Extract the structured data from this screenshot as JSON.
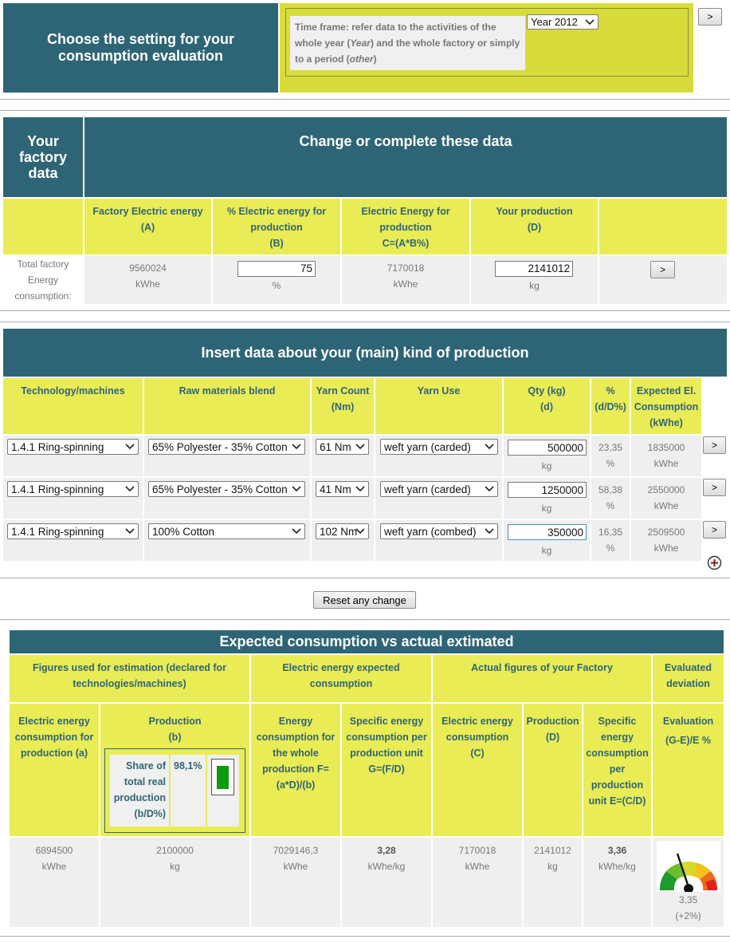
{
  "settings": {
    "title_line1": "Choose the setting for your",
    "title_line2": "consumption evaluation",
    "timeframe_prefix": "Time frame: refer data to the activities of the whole year (",
    "timeframe_year_word": "Year",
    "timeframe_middle": ") and the whole factory or simply to a period (",
    "timeframe_other_word": "other",
    "timeframe_suffix": ")",
    "year_select": "Year 2012",
    "go_button": ">"
  },
  "factory": {
    "side_title": "Your factory data",
    "main_title": "Change or complete these data",
    "col_a": "Factory Electric energy",
    "col_a_sub": "(A)",
    "col_b": "% Electric energy for production",
    "col_b_sub": "(B)",
    "col_c": "Electric Energy for production",
    "col_c_sub": "C=(A*B%)",
    "col_d": "Your production",
    "col_d_sub": "(D)",
    "row_label": "Total factory Energy consumption:",
    "a_value": "9560024",
    "a_unit": "kWhe",
    "b_value": "75",
    "b_unit": "%",
    "c_value": "7170018",
    "c_unit": "kWhe",
    "d_value": "2141012",
    "d_unit": "kg",
    "go_button": ">"
  },
  "production": {
    "title": "Insert data about your (main) kind of production",
    "headers": {
      "tech": "Technology/machines",
      "blend": "Raw materials blend",
      "count": "Yarn Count",
      "count_sub": "(Nm)",
      "use": "Yarn Use",
      "qty": "Qty (kg)",
      "qty_sub": "(d)",
      "pct": "%",
      "pct_sub": "(d/D%)",
      "expected": "Expected El. Consumption (kWhe)"
    },
    "rows": [
      {
        "tech": "1.4.1 Ring-spinning",
        "blend": "65% Polyester - 35% Cotton",
        "count": "61 Nm",
        "use": "weft yarn (carded)",
        "qty": "500000",
        "qty_unit": "kg",
        "pct": "23,35",
        "pct_unit": "%",
        "expected": "1835000",
        "expected_unit": "kWhe",
        "go": ">"
      },
      {
        "tech": "1.4.1 Ring-spinning",
        "blend": "65% Polyester - 35% Cotton",
        "count": "41 Nm",
        "use": "weft yarn (carded)",
        "qty": "1250000",
        "qty_unit": "kg",
        "pct": "58,38",
        "pct_unit": "%",
        "expected": "2550000",
        "expected_unit": "kWhe",
        "go": ">"
      },
      {
        "tech": "1.4.1 Ring-spinning",
        "blend": "100% Cotton",
        "count": "102 Nm",
        "use": "weft yarn (combed)",
        "qty": "350000",
        "qty_unit": "kg",
        "pct": "16,35",
        "pct_unit": "%",
        "expected": "2509500",
        "expected_unit": "kWhe",
        "go": ">"
      }
    ],
    "reset_button": "Reset any change"
  },
  "expected": {
    "title": "Expected consumption vs actual extimated",
    "group_figures": "Figures used for estimation (declared for technologies/machines)",
    "group_expected": "Electric energy expected consumption",
    "group_actual": "Actual figures of your Factory",
    "group_dev": "Evaluated deviation",
    "h_a": "Electric energy consumption for production (a)",
    "h_b": "Production",
    "h_b_sub": "(b)",
    "share_label": "Share of total real production (b/D%)",
    "share_value": "98,1%",
    "h_f": "Energy consumption for the whole production F=(a*D)/(b)",
    "h_g": "Specific energy consumption per production unit G=(F/D)",
    "h_c": "Electric energy consumption (C)",
    "h_d": "Production (D)",
    "h_e": "Specific energy consumption per production unit E=(C/D)",
    "h_eval": "Evaluation",
    "h_eval_sub": "(G-E)/E %",
    "a_value": "6894500",
    "a_unit": "kWhe",
    "b_value": "2100000",
    "b_unit": "kg",
    "f_value": "7029146,3",
    "f_unit": "kWhe",
    "g_value": "3,28",
    "g_unit": "kWhe/kg",
    "c_value": "7170018",
    "c_unit": "kWhe",
    "d_value": "2141012",
    "d_unit": "kg",
    "e_value": "3,36",
    "e_unit": "kWhe/kg",
    "gauge_value": "3,35",
    "gauge_pct": "(+2%)",
    "share_fraction": 0.981
  }
}
